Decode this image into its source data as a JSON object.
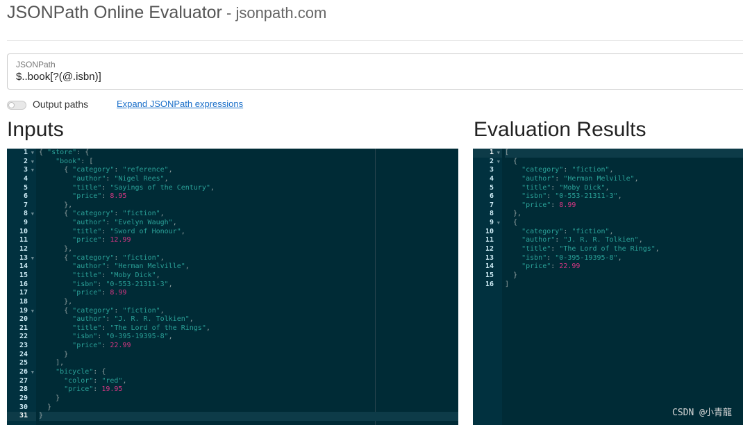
{
  "header": {
    "title": "JSONPath Online Evaluator",
    "subtitle": " - jsonpath.com"
  },
  "jsonpath": {
    "label": "JSONPath",
    "value": "$..book[?(@.isbn)]"
  },
  "options": {
    "output_paths_label": "Output paths",
    "output_paths_enabled": false,
    "expand_link": "Expand JSONPath expressions"
  },
  "inputs": {
    "title": "Inputs",
    "lines": [
      [
        [
          "p",
          "{ "
        ],
        [
          "k",
          "\"store\""
        ],
        [
          "p",
          ": {"
        ]
      ],
      [
        [
          "p",
          "    "
        ],
        [
          "k",
          "\"book\""
        ],
        [
          "p",
          ": ["
        ]
      ],
      [
        [
          "p",
          "      { "
        ],
        [
          "k",
          "\"category\""
        ],
        [
          "p",
          ": "
        ],
        [
          "s",
          "\"reference\""
        ],
        [
          "p",
          ","
        ]
      ],
      [
        [
          "p",
          "        "
        ],
        [
          "k",
          "\"author\""
        ],
        [
          "p",
          ": "
        ],
        [
          "s",
          "\"Nigel Rees\""
        ],
        [
          "p",
          ","
        ]
      ],
      [
        [
          "p",
          "        "
        ],
        [
          "k",
          "\"title\""
        ],
        [
          "p",
          ": "
        ],
        [
          "s",
          "\"Sayings of the Century\""
        ],
        [
          "p",
          ","
        ]
      ],
      [
        [
          "p",
          "        "
        ],
        [
          "k",
          "\"price\""
        ],
        [
          "p",
          ": "
        ],
        [
          "n",
          "8.95"
        ]
      ],
      [
        [
          "p",
          "      },"
        ]
      ],
      [
        [
          "p",
          "      { "
        ],
        [
          "k",
          "\"category\""
        ],
        [
          "p",
          ": "
        ],
        [
          "s",
          "\"fiction\""
        ],
        [
          "p",
          ","
        ]
      ],
      [
        [
          "p",
          "        "
        ],
        [
          "k",
          "\"author\""
        ],
        [
          "p",
          ": "
        ],
        [
          "s",
          "\"Evelyn Waugh\""
        ],
        [
          "p",
          ","
        ]
      ],
      [
        [
          "p",
          "        "
        ],
        [
          "k",
          "\"title\""
        ],
        [
          "p",
          ": "
        ],
        [
          "s",
          "\"Sword of Honour\""
        ],
        [
          "p",
          ","
        ]
      ],
      [
        [
          "p",
          "        "
        ],
        [
          "k",
          "\"price\""
        ],
        [
          "p",
          ": "
        ],
        [
          "n",
          "12.99"
        ]
      ],
      [
        [
          "p",
          "      },"
        ]
      ],
      [
        [
          "p",
          "      { "
        ],
        [
          "k",
          "\"category\""
        ],
        [
          "p",
          ": "
        ],
        [
          "s",
          "\"fiction\""
        ],
        [
          "p",
          ","
        ]
      ],
      [
        [
          "p",
          "        "
        ],
        [
          "k",
          "\"author\""
        ],
        [
          "p",
          ": "
        ],
        [
          "s",
          "\"Herman Melville\""
        ],
        [
          "p",
          ","
        ]
      ],
      [
        [
          "p",
          "        "
        ],
        [
          "k",
          "\"title\""
        ],
        [
          "p",
          ": "
        ],
        [
          "s",
          "\"Moby Dick\""
        ],
        [
          "p",
          ","
        ]
      ],
      [
        [
          "p",
          "        "
        ],
        [
          "k",
          "\"isbn\""
        ],
        [
          "p",
          ": "
        ],
        [
          "s",
          "\"0-553-21311-3\""
        ],
        [
          "p",
          ","
        ]
      ],
      [
        [
          "p",
          "        "
        ],
        [
          "k",
          "\"price\""
        ],
        [
          "p",
          ": "
        ],
        [
          "n",
          "8.99"
        ]
      ],
      [
        [
          "p",
          "      },"
        ]
      ],
      [
        [
          "p",
          "      { "
        ],
        [
          "k",
          "\"category\""
        ],
        [
          "p",
          ": "
        ],
        [
          "s",
          "\"fiction\""
        ],
        [
          "p",
          ","
        ]
      ],
      [
        [
          "p",
          "        "
        ],
        [
          "k",
          "\"author\""
        ],
        [
          "p",
          ": "
        ],
        [
          "s",
          "\"J. R. R. Tolkien\""
        ],
        [
          "p",
          ","
        ]
      ],
      [
        [
          "p",
          "        "
        ],
        [
          "k",
          "\"title\""
        ],
        [
          "p",
          ": "
        ],
        [
          "s",
          "\"The Lord of the Rings\""
        ],
        [
          "p",
          ","
        ]
      ],
      [
        [
          "p",
          "        "
        ],
        [
          "k",
          "\"isbn\""
        ],
        [
          "p",
          ": "
        ],
        [
          "s",
          "\"0-395-19395-8\""
        ],
        [
          "p",
          ","
        ]
      ],
      [
        [
          "p",
          "        "
        ],
        [
          "k",
          "\"price\""
        ],
        [
          "p",
          ": "
        ],
        [
          "n",
          "22.99"
        ]
      ],
      [
        [
          "p",
          "      }"
        ]
      ],
      [
        [
          "p",
          "    ],"
        ]
      ],
      [
        [
          "p",
          "    "
        ],
        [
          "k",
          "\"bicycle\""
        ],
        [
          "p",
          ": {"
        ]
      ],
      [
        [
          "p",
          "      "
        ],
        [
          "k",
          "\"color\""
        ],
        [
          "p",
          ": "
        ],
        [
          "s",
          "\"red\""
        ],
        [
          "p",
          ","
        ]
      ],
      [
        [
          "p",
          "      "
        ],
        [
          "k",
          "\"price\""
        ],
        [
          "p",
          ": "
        ],
        [
          "n",
          "19.95"
        ]
      ],
      [
        [
          "p",
          "    }"
        ]
      ],
      [
        [
          "p",
          "  }"
        ]
      ],
      [
        [
          "p",
          "}"
        ]
      ]
    ],
    "fold_lines": [
      1,
      2,
      3,
      8,
      13,
      19,
      26
    ],
    "active_line": 31
  },
  "results": {
    "title": "Evaluation Results",
    "lines": [
      [
        [
          "p",
          "["
        ]
      ],
      [
        [
          "p",
          "  {"
        ]
      ],
      [
        [
          "p",
          "    "
        ],
        [
          "k",
          "\"category\""
        ],
        [
          "p",
          ": "
        ],
        [
          "s",
          "\"fiction\""
        ],
        [
          "p",
          ","
        ]
      ],
      [
        [
          "p",
          "    "
        ],
        [
          "k",
          "\"author\""
        ],
        [
          "p",
          ": "
        ],
        [
          "s",
          "\"Herman Melville\""
        ],
        [
          "p",
          ","
        ]
      ],
      [
        [
          "p",
          "    "
        ],
        [
          "k",
          "\"title\""
        ],
        [
          "p",
          ": "
        ],
        [
          "s",
          "\"Moby Dick\""
        ],
        [
          "p",
          ","
        ]
      ],
      [
        [
          "p",
          "    "
        ],
        [
          "k",
          "\"isbn\""
        ],
        [
          "p",
          ": "
        ],
        [
          "s",
          "\"0-553-21311-3\""
        ],
        [
          "p",
          ","
        ]
      ],
      [
        [
          "p",
          "    "
        ],
        [
          "k",
          "\"price\""
        ],
        [
          "p",
          ": "
        ],
        [
          "n",
          "8.99"
        ]
      ],
      [
        [
          "p",
          "  },"
        ]
      ],
      [
        [
          "p",
          "  {"
        ]
      ],
      [
        [
          "p",
          "    "
        ],
        [
          "k",
          "\"category\""
        ],
        [
          "p",
          ": "
        ],
        [
          "s",
          "\"fiction\""
        ],
        [
          "p",
          ","
        ]
      ],
      [
        [
          "p",
          "    "
        ],
        [
          "k",
          "\"author\""
        ],
        [
          "p",
          ": "
        ],
        [
          "s",
          "\"J. R. R. Tolkien\""
        ],
        [
          "p",
          ","
        ]
      ],
      [
        [
          "p",
          "    "
        ],
        [
          "k",
          "\"title\""
        ],
        [
          "p",
          ": "
        ],
        [
          "s",
          "\"The Lord of the Rings\""
        ],
        [
          "p",
          ","
        ]
      ],
      [
        [
          "p",
          "    "
        ],
        [
          "k",
          "\"isbn\""
        ],
        [
          "p",
          ": "
        ],
        [
          "s",
          "\"0-395-19395-8\""
        ],
        [
          "p",
          ","
        ]
      ],
      [
        [
          "p",
          "    "
        ],
        [
          "k",
          "\"price\""
        ],
        [
          "p",
          ": "
        ],
        [
          "n",
          "22.99"
        ]
      ],
      [
        [
          "p",
          "  }"
        ]
      ],
      [
        [
          "p",
          "]"
        ]
      ]
    ],
    "fold_lines": [
      1,
      2,
      9
    ],
    "active_line": 1
  },
  "watermark": "CSDN @小青龍",
  "colors": {
    "editor_bg": "#002b36",
    "key": "#2aa198",
    "string": "#2aa198",
    "number": "#d33682",
    "link": "#1a6fc9"
  }
}
